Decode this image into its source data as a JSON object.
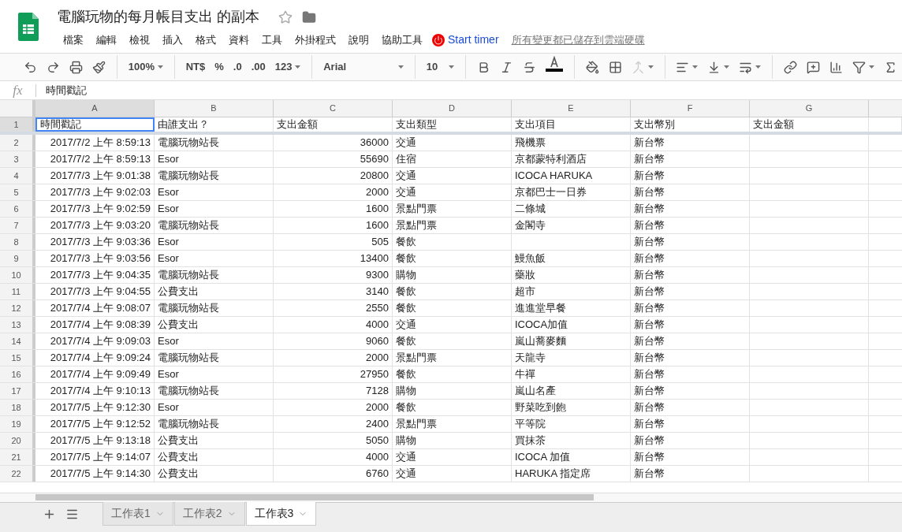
{
  "doc": {
    "title": "電腦玩物的每月帳目支出 的副本",
    "starred": false
  },
  "menu": [
    "檔案",
    "編輯",
    "檢視",
    "插入",
    "格式",
    "資料",
    "工具",
    "外掛程式",
    "說明",
    "協助工具"
  ],
  "addon": {
    "label": "Start timer"
  },
  "save_status": "所有變更都已儲存到雲端硬碟",
  "toolbar": {
    "zoom": "100%",
    "currency": "NT$",
    "percent": "%",
    "dec_less": ".0",
    "dec_more": ".00",
    "number_format": "123",
    "font": "Arial",
    "font_size": "10",
    "merge_disabled": true
  },
  "formula_bar": {
    "label": "fx",
    "value": "時間戳記"
  },
  "columns": [
    "A",
    "B",
    "C",
    "D",
    "E",
    "F",
    "G"
  ],
  "header_row": {
    "number": "1",
    "cells": [
      {
        "text": "時間戳記",
        "selected": true
      },
      {
        "text": "由誰支出？",
        "selected": false
      },
      {
        "text": "支出金額",
        "selected": false
      },
      {
        "text": "支出類型",
        "selected": false
      },
      {
        "text": "支出項目",
        "selected": false
      },
      {
        "text": "支出幣別",
        "selected": false
      },
      {
        "text": "支出金額",
        "selected": false
      }
    ]
  },
  "rows": [
    {
      "number": "2",
      "timestamp": "2017/7/2 上午 8:59:13",
      "payer": "電腦玩物站長",
      "amount": "36000",
      "type": "交通",
      "item": "飛機票",
      "currency": "新台幣"
    },
    {
      "number": "3",
      "timestamp": "2017/7/2 上午 8:59:13",
      "payer": "Esor",
      "amount": "55690",
      "type": "住宿",
      "item": "京都蒙特利酒店",
      "currency": "新台幣"
    },
    {
      "number": "4",
      "timestamp": "2017/7/3 上午 9:01:38",
      "payer": "電腦玩物站長",
      "amount": "20800",
      "type": "交通",
      "item": "ICOCA HARUKA",
      "currency": "新台幣"
    },
    {
      "number": "5",
      "timestamp": "2017/7/3 上午 9:02:03",
      "payer": "Esor",
      "amount": "2000",
      "type": "交通",
      "item": "京都巴士一日券",
      "currency": "新台幣"
    },
    {
      "number": "6",
      "timestamp": "2017/7/3 上午 9:02:59",
      "payer": "Esor",
      "amount": "1600",
      "type": "景點門票",
      "item": "二條城",
      "currency": "新台幣"
    },
    {
      "number": "7",
      "timestamp": "2017/7/3 上午 9:03:20",
      "payer": "電腦玩物站長",
      "amount": "1600",
      "type": "景點門票",
      "item": "金閣寺",
      "currency": "新台幣"
    },
    {
      "number": "8",
      "timestamp": "2017/7/3 上午 9:03:36",
      "payer": "Esor",
      "amount": "505",
      "type": "餐飲",
      "currency": "新台幣"
    },
    {
      "number": "9",
      "timestamp": "2017/7/3 上午 9:03:56",
      "payer": "Esor",
      "amount": "13400",
      "type": "餐飲",
      "item": "鰻魚飯",
      "currency": "新台幣"
    },
    {
      "number": "10",
      "timestamp": "2017/7/3 上午 9:04:35",
      "payer": "電腦玩物站長",
      "amount": "9300",
      "type": "購物",
      "item": "藥妝",
      "currency": "新台幣"
    },
    {
      "number": "11",
      "timestamp": "2017/7/3 上午 9:04:55",
      "payer": "公費支出",
      "amount": "3140",
      "type": "餐飲",
      "item": "超市",
      "currency": "新台幣"
    },
    {
      "number": "12",
      "timestamp": "2017/7/4 上午 9:08:07",
      "payer": "電腦玩物站長",
      "amount": "2550",
      "type": "餐飲",
      "item": "進進堂早餐",
      "currency": "新台幣"
    },
    {
      "number": "13",
      "timestamp": "2017/7/4 上午 9:08:39",
      "payer": "公費支出",
      "amount": "4000",
      "type": "交通",
      "item": "ICOCA加值",
      "currency": "新台幣"
    },
    {
      "number": "14",
      "timestamp": "2017/7/4 上午 9:09:03",
      "payer": "Esor",
      "amount": "9060",
      "type": "餐飲",
      "item": "嵐山蕎麥麵",
      "currency": "新台幣"
    },
    {
      "number": "15",
      "timestamp": "2017/7/4 上午 9:09:24",
      "payer": "電腦玩物站長",
      "amount": "2000",
      "type": "景點門票",
      "item": "天龍寺",
      "currency": "新台幣"
    },
    {
      "number": "16",
      "timestamp": "2017/7/4 上午 9:09:49",
      "payer": "Esor",
      "amount": "27950",
      "type": "餐飲",
      "item": "牛禪",
      "currency": "新台幣"
    },
    {
      "number": "17",
      "timestamp": "2017/7/4 上午 9:10:13",
      "payer": "電腦玩物站長",
      "amount": "7128",
      "type": "購物",
      "item": "嵐山名產",
      "currency": "新台幣"
    },
    {
      "number": "18",
      "timestamp": "2017/7/5 上午 9:12:30",
      "payer": "Esor",
      "amount": "2000",
      "type": "餐飲",
      "item": "野菜吃到飽",
      "currency": "新台幣"
    },
    {
      "number": "19",
      "timestamp": "2017/7/5 上午 9:12:52",
      "payer": "電腦玩物站長",
      "amount": "2400",
      "type": "景點門票",
      "item": "平等院",
      "currency": "新台幣"
    },
    {
      "number": "20",
      "timestamp": "2017/7/5 上午 9:13:18",
      "payer": "公費支出",
      "amount": "5050",
      "type": "購物",
      "item": "買抹茶",
      "currency": "新台幣"
    },
    {
      "number": "21",
      "timestamp": "2017/7/5 上午 9:14:07",
      "payer": "公費支出",
      "amount": "4000",
      "type": "交通",
      "item": "ICOCA 加值",
      "currency": "新台幣"
    },
    {
      "number": "22",
      "timestamp": "2017/7/5 上午 9:14:30",
      "payer": "公費支出",
      "amount": "6760",
      "type": "交通",
      "item": "HARUKA 指定席",
      "currency": "新台幣"
    }
  ],
  "sheet_tabs": [
    {
      "label": "工作表1",
      "selected": false
    },
    {
      "label": "工作表2",
      "selected": false
    },
    {
      "label": "工作表3",
      "selected": true
    }
  ]
}
